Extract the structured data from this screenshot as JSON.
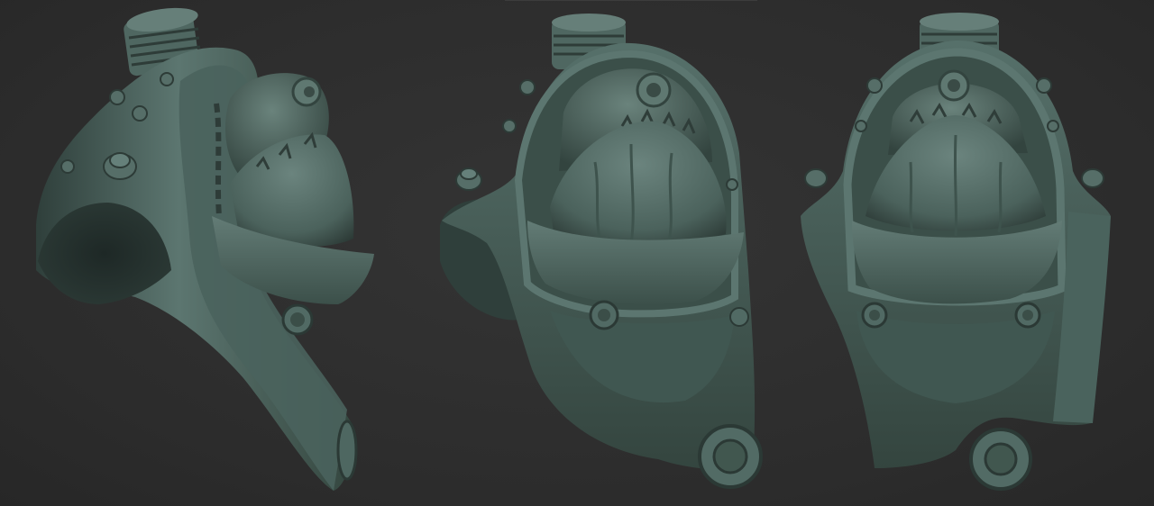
{
  "scene": {
    "background_color": "#2e2e2e",
    "model_color": "#4d6660",
    "render_style": "clay sculpt render",
    "views": [
      {
        "id": "three-quarter-left",
        "label": ""
      },
      {
        "id": "three-quarter-front",
        "label": ""
      },
      {
        "id": "front",
        "label": ""
      }
    ]
  }
}
